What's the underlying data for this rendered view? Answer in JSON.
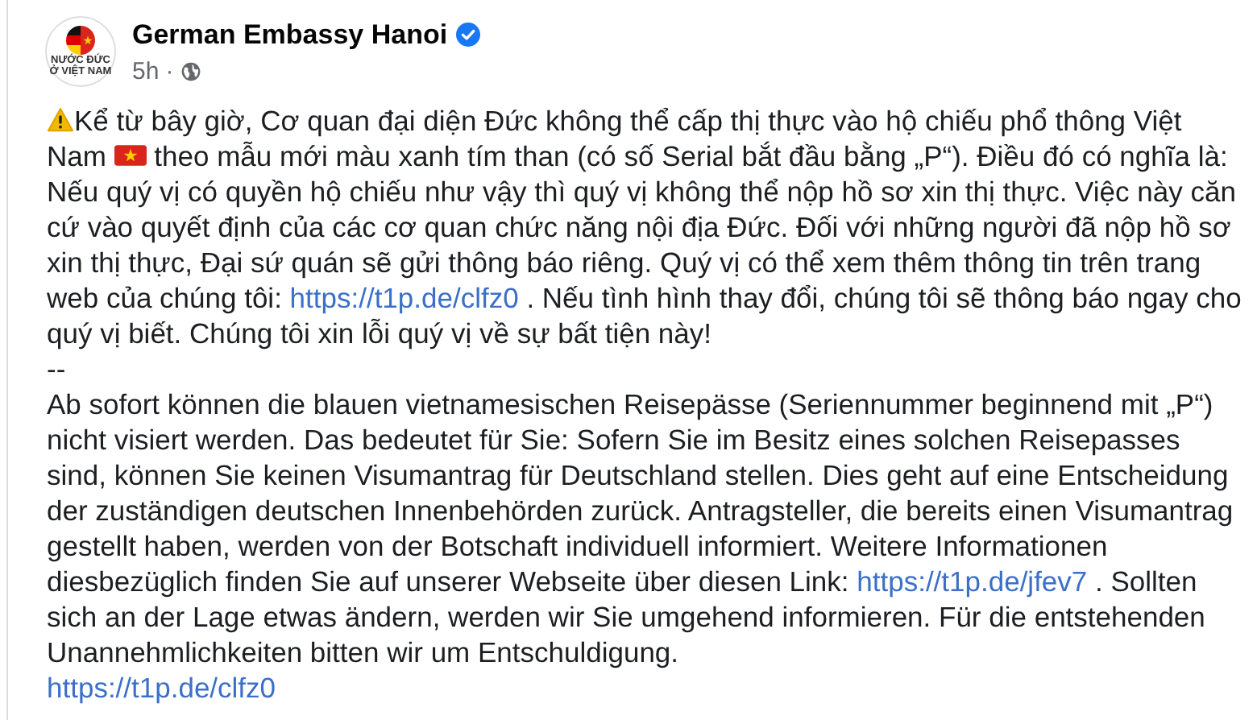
{
  "post": {
    "author": "German Embassy Hanoi",
    "verified": true,
    "avatar_caption": "NƯỚC ĐỨC Ở VIỆT NAM",
    "time": "5h",
    "separator": "·"
  },
  "paragraphs": [
    {
      "segments": [
        {
          "kind": "warning"
        },
        {
          "kind": "text",
          "text": "Kể từ bây giờ, Cơ quan đại diện Đức không thể cấp thị thực vào hộ chiếu phổ thông Việt Nam "
        },
        {
          "kind": "flag"
        },
        {
          "kind": "text",
          "text": " theo mẫu mới màu xanh tím than (có số Serial bắt đầu bằng „P“). Điều đó có nghĩa là: Nếu quý vị có quyền hộ chiếu như vậy thì quý vị không thể nộp hồ sơ xin thị thực. Việc này căn cứ vào quyết định của các cơ quan chức năng nội địa Đức. Đối với những người đã nộp hồ sơ xin thị thực, Đại sứ quán sẽ gửi thông báo riêng. Quý vị có thể xem thêm thông tin trên trang web của chúng tôi: "
        },
        {
          "kind": "link",
          "text": "https://t1p.de/clfz0"
        },
        {
          "kind": "text",
          "text": " . Nếu tình hình thay đổi, chúng tôi sẽ thông báo ngay cho quý vị biết. Chúng tôi xin lỗi quý vị về sự bất tiện này!"
        }
      ]
    },
    {
      "segments": [
        {
          "kind": "text",
          "text": "--"
        }
      ]
    },
    {
      "segments": [
        {
          "kind": "text",
          "text": "Ab sofort können die blauen vietnamesischen Reisepässe (Seriennummer beginnend mit „P“) nicht visiert werden. Das bedeutet für Sie: Sofern Sie im Besitz eines solchen Reisepasses sind, können Sie keinen Visumantrag für Deutschland stellen. Dies geht auf eine Entscheidung der zuständigen deutschen Innenbehörden zurück. Antragsteller, die bereits einen Visumantrag gestellt haben, werden von der Botschaft individuell informiert. Weitere Informationen diesbezüglich finden Sie auf unserer Webseite über diesen Link: "
        },
        {
          "kind": "link",
          "text": "https://t1p.de/jfev7"
        },
        {
          "kind": "text",
          "text": " . Sollten sich an der Lage etwas ändern, werden wir Sie umgehend informieren. Für die entstehenden Unannehmlichkeiten bitten wir um Entschuldigung."
        }
      ]
    },
    {
      "segments": [
        {
          "kind": "link",
          "text": "https://t1p.de/clfz0"
        }
      ]
    }
  ]
}
